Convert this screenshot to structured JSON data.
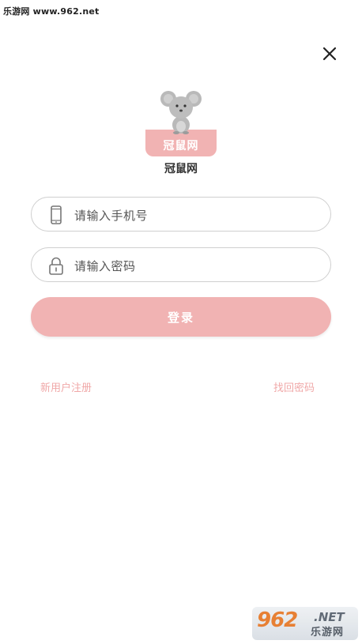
{
  "watermark": {
    "top_text": "乐游网 www.962.net",
    "bottom_number": "962",
    "bottom_suffix": ".NET",
    "bottom_cn": "乐游网"
  },
  "header": {
    "close_icon": "close-icon"
  },
  "brand": {
    "logo_text": "冠鼠网",
    "app_name": "冠鼠网",
    "accent_color": "#f1b3b3"
  },
  "form": {
    "phone": {
      "icon": "phone-icon",
      "placeholder": "请输入手机号"
    },
    "password": {
      "icon": "lock-icon",
      "placeholder": "请输入密码"
    },
    "login_label": "登录"
  },
  "links": {
    "register": "新用户注册",
    "forgot": "找回密码"
  }
}
